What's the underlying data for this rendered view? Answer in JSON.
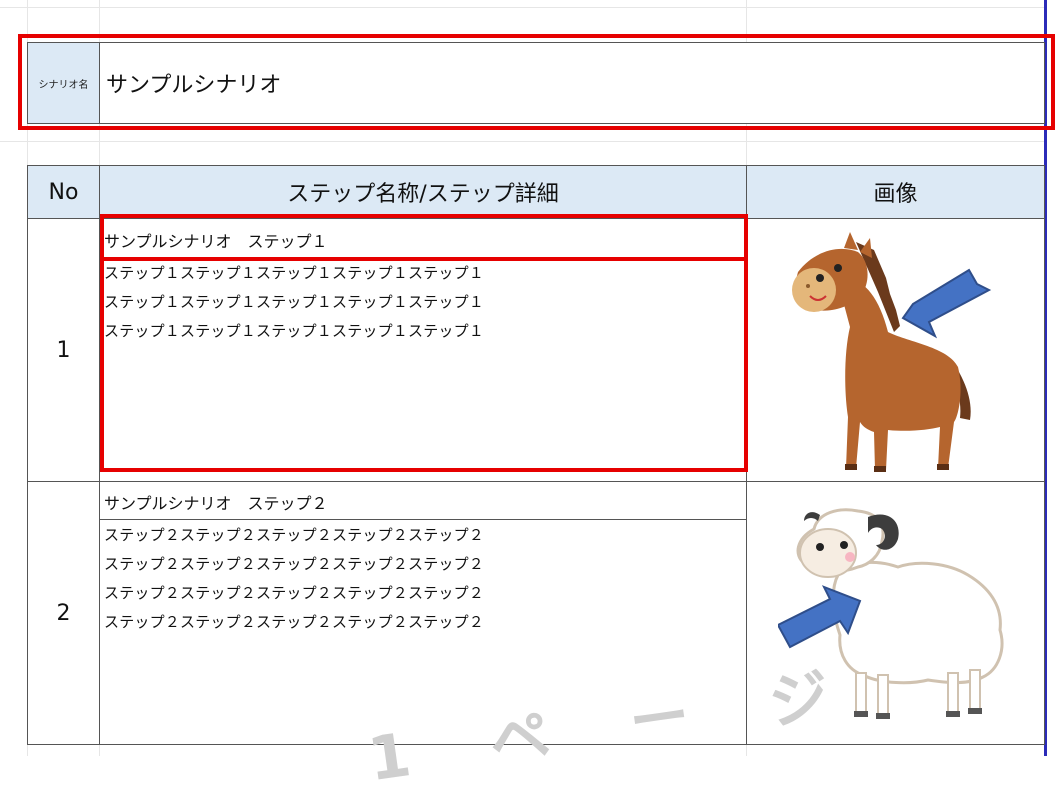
{
  "scenario": {
    "label": "シナリオ名",
    "name": "サンプルシナリオ"
  },
  "table": {
    "headers": {
      "no": "No",
      "step": "ステップ名称/ステップ詳細",
      "image": "画像"
    },
    "rows": [
      {
        "no": "1",
        "title": "サンプルシナリオ　ステップ１",
        "details": [
          "ステップ１ステップ１ステップ１ステップ１ステップ１",
          "ステップ１ステップ１ステップ１ステップ１ステップ１",
          "ステップ１ステップ１ステップ１ステップ１ステップ１"
        ],
        "image_icon": "horse-illustration"
      },
      {
        "no": "2",
        "title": "サンプルシナリオ　ステップ２",
        "details": [
          "ステップ２ステップ２ステップ２ステップ２ステップ２",
          "ステップ２ステップ２ステップ２ステップ２ステップ２",
          "ステップ２ステップ２ステップ２ステップ２ステップ２",
          "ステップ２ステップ２ステップ２ステップ２ステップ２"
        ],
        "image_icon": "sheep-illustration"
      }
    ]
  },
  "watermark": "1 ペ ー ジ",
  "colors": {
    "header_bg": "#dce9f5",
    "highlight": "#e60000",
    "arrow": "#4472c4",
    "page_break": "#2b2bb8"
  }
}
